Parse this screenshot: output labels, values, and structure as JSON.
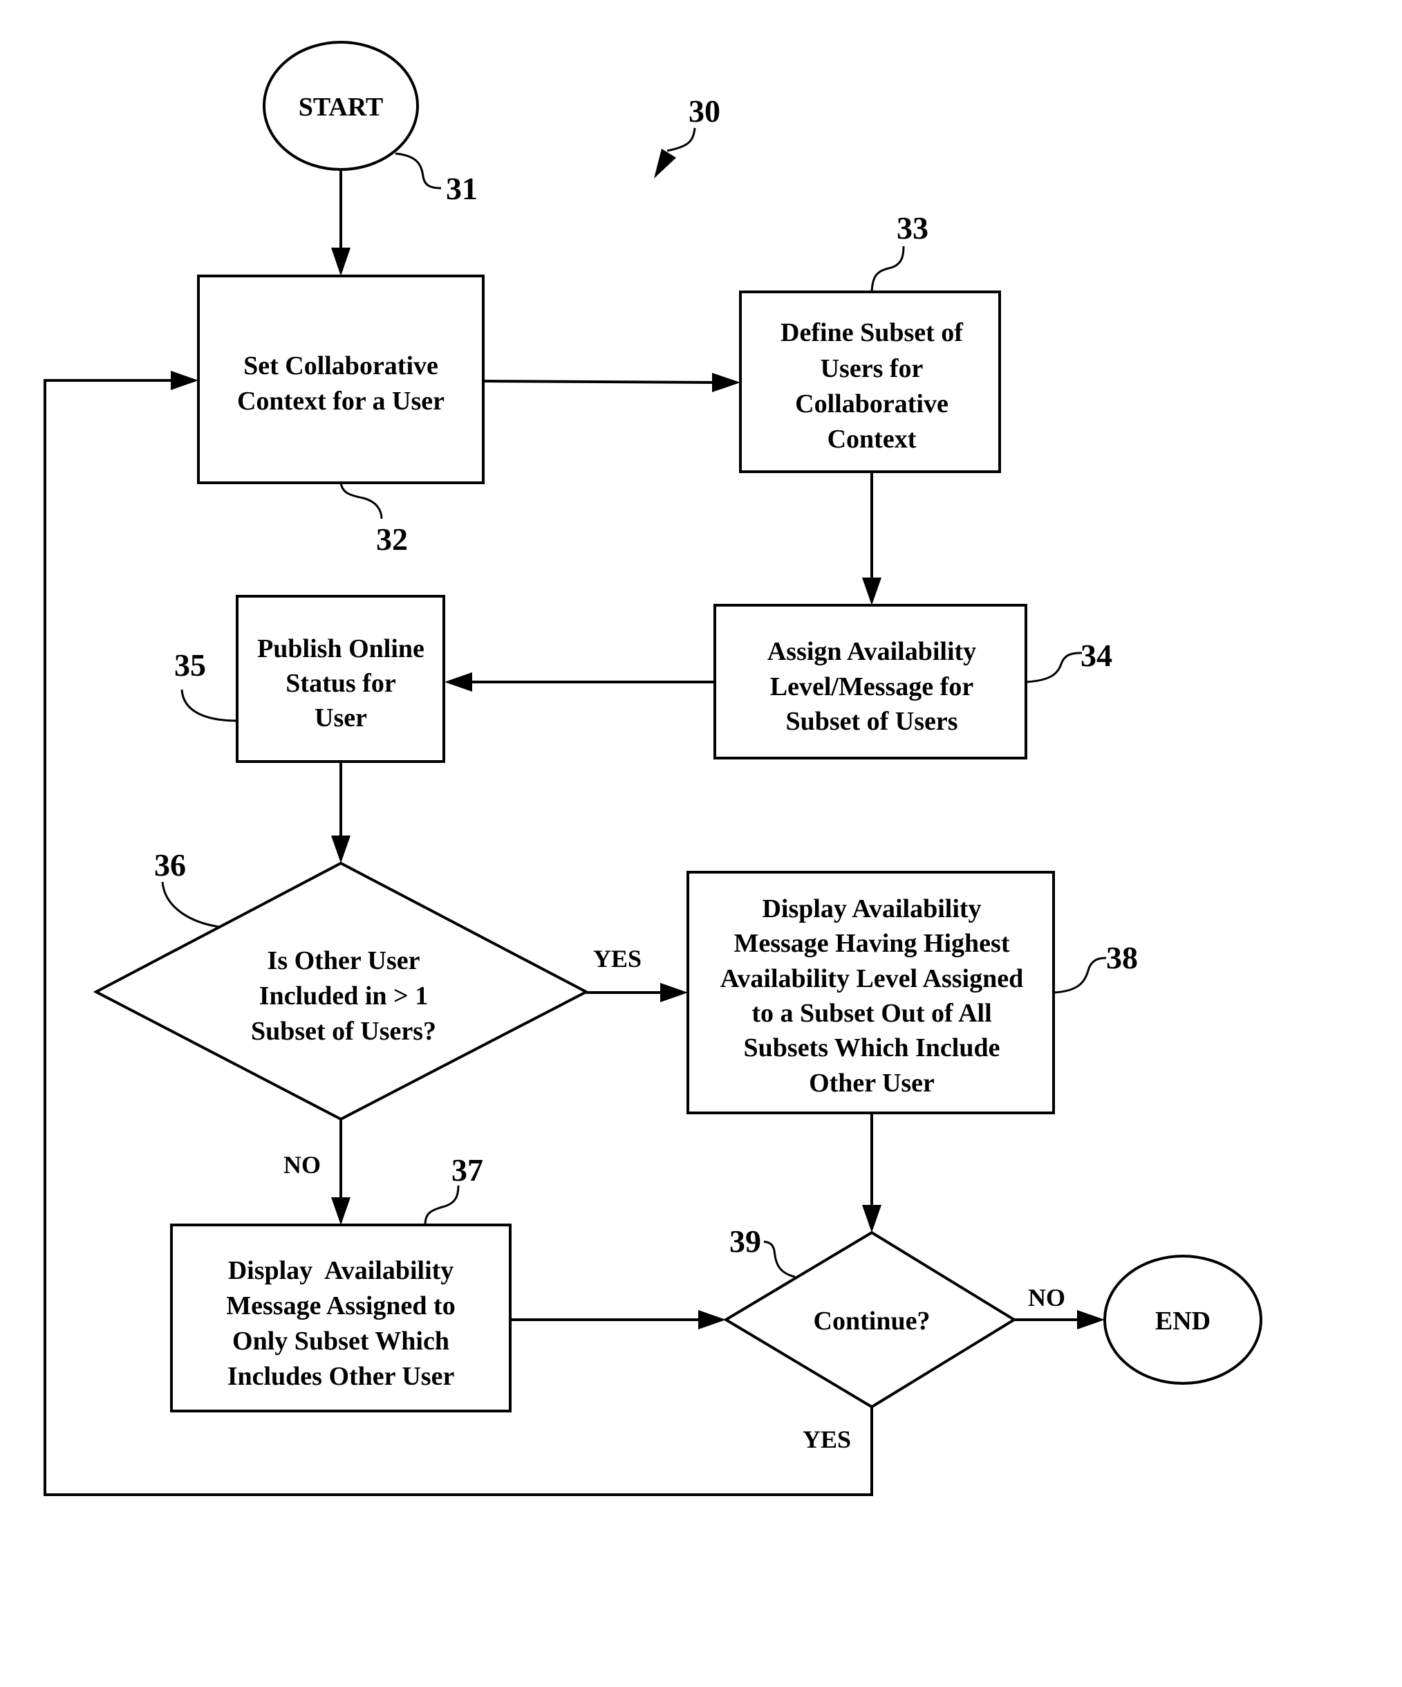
{
  "figure": {
    "reference": "30",
    "nodes": [
      {
        "id": "start",
        "ref": "31",
        "type": "terminal",
        "lines": [
          "START"
        ]
      },
      {
        "id": "set-context",
        "ref": "32",
        "type": "process",
        "lines": [
          "Set Collaborative",
          "Context for a User"
        ]
      },
      {
        "id": "define-subset",
        "ref": "33",
        "type": "process",
        "lines": [
          "Define Subset of",
          "Users for",
          "Collaborative",
          "Context"
        ]
      },
      {
        "id": "assign-availability",
        "ref": "34",
        "type": "process",
        "lines": [
          "Assign Availability",
          "Level/Message for",
          "Subset of Users"
        ]
      },
      {
        "id": "publish-status",
        "ref": "35",
        "type": "process",
        "lines": [
          "Publish Online",
          "Status for",
          "User"
        ]
      },
      {
        "id": "decision-multiple-subsets",
        "ref": "36",
        "type": "decision",
        "lines": [
          "Is Other User",
          "Included in > 1",
          "Subset of Users?"
        ]
      },
      {
        "id": "display-single",
        "ref": "37",
        "type": "process",
        "lines": [
          "Display  Availability",
          "Message Assigned to",
          "Only Subset Which",
          "Includes Other User"
        ]
      },
      {
        "id": "display-highest",
        "ref": "38",
        "type": "process",
        "lines": [
          "Display Availability",
          "Message Having Highest",
          "Availability Level Assigned",
          "to a Subset Out of All",
          "Subsets Which Include",
          "Other User"
        ]
      },
      {
        "id": "decision-continue",
        "ref": "39",
        "type": "decision",
        "lines": [
          "Continue?"
        ]
      },
      {
        "id": "end",
        "type": "terminal",
        "lines": [
          "END"
        ]
      }
    ],
    "branch_labels": {
      "d36_yes": "YES",
      "d36_no": "NO",
      "d39_no": "NO",
      "d39_yes": "YES"
    }
  }
}
